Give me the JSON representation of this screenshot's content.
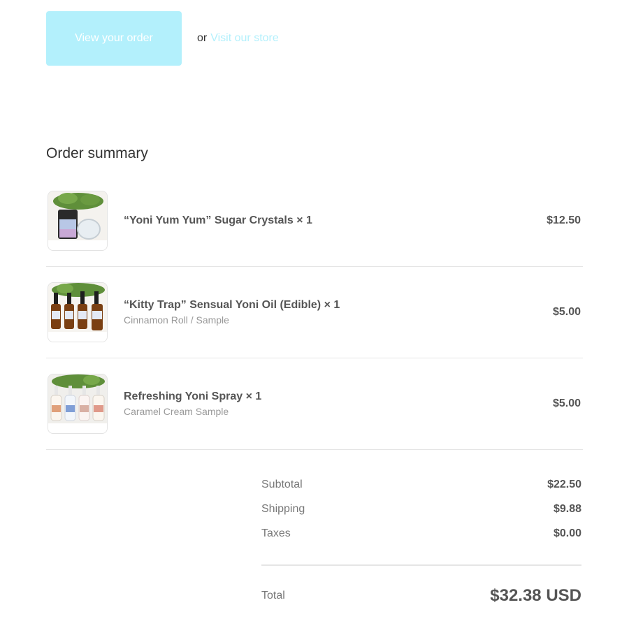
{
  "actions": {
    "view_order_label": "View your order",
    "or_text": "or",
    "visit_store_label": "Visit our store"
  },
  "summary": {
    "title": "Order summary",
    "items": [
      {
        "name": "“Yoni Yum Yum” Sugar Crystals × 1",
        "variant": "",
        "price": "$12.50",
        "image": "sugar-crystals-product-image"
      },
      {
        "name": "“Kitty Trap” Sensual Yoni Oil (Edible) × 1",
        "variant": "Cinnamon Roll / Sample",
        "price": "$5.00",
        "image": "yoni-oil-product-image"
      },
      {
        "name": "Refreshing Yoni Spray × 1",
        "variant": "Caramel Cream Sample",
        "price": "$5.00",
        "image": "yoni-spray-product-image"
      }
    ]
  },
  "totals": {
    "subtotal_label": "Subtotal",
    "subtotal_value": "$22.50",
    "shipping_label": "Shipping",
    "shipping_value": "$9.88",
    "taxes_label": "Taxes",
    "taxes_value": "$0.00",
    "total_label": "Total",
    "total_value": "$32.38 USD"
  },
  "colors": {
    "button_bg": "#b3f0fc",
    "link": "#b3f0fc",
    "text": "#555555"
  }
}
